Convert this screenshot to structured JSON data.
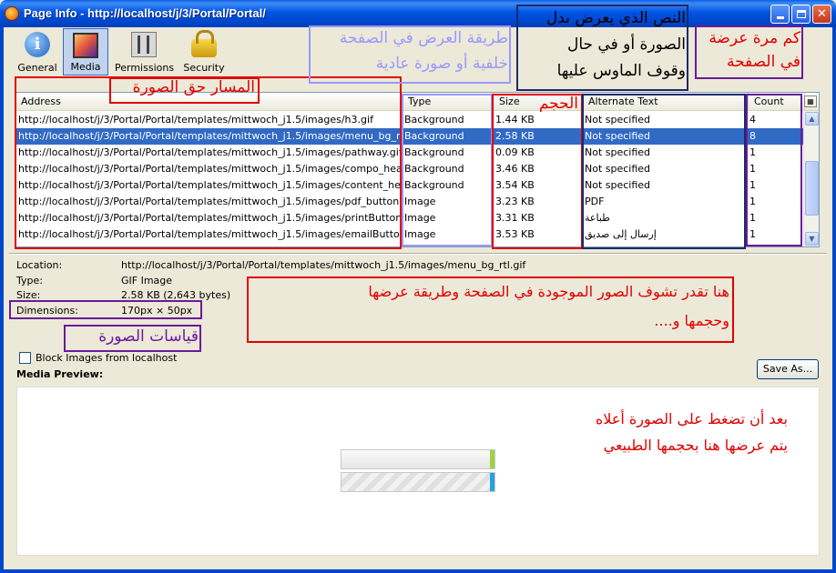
{
  "window": {
    "title": "Page Info - http://localhost/j/3/Portal/Portal/",
    "colors": {
      "titlebar": "#0054e3",
      "selection": "#316ac5",
      "annotation_red": "#e00000",
      "annotation_blue": "#9999ff",
      "annotation_purple": "#6a1b9a"
    }
  },
  "toolbar": {
    "general": "General",
    "media": "Media",
    "permissions": "Permissions",
    "security": "Security"
  },
  "table": {
    "headers": {
      "address": "Address",
      "type": "Type",
      "size": "Size",
      "alt": "Alternate Text",
      "count": "Count"
    },
    "rows": [
      {
        "address": "http://localhost/j/3/Portal/Portal/templates/mittwoch_j1.5/images/h3.gif",
        "type": "Background",
        "size": "1.44 KB",
        "alt": "Not specified",
        "count": "4"
      },
      {
        "address": "http://localhost/j/3/Portal/Portal/templates/mittwoch_j1.5/images/menu_bg_rtl.gif",
        "type": "Background",
        "size": "2.58 KB",
        "alt": "Not specified",
        "count": "8"
      },
      {
        "address": "http://localhost/j/3/Portal/Portal/templates/mittwoch_j1.5/images/pathway.gif",
        "type": "Background",
        "size": "0.09 KB",
        "alt": "Not specified",
        "count": "1"
      },
      {
        "address": "http://localhost/j/3/Portal/Portal/templates/mittwoch_j1.5/images/compo_head.png",
        "type": "Background",
        "size": "3.46 KB",
        "alt": "Not specified",
        "count": "1"
      },
      {
        "address": "http://localhost/j/3/Portal/Portal/templates/mittwoch_j1.5/images/content_head.png",
        "type": "Background",
        "size": "3.54 KB",
        "alt": "Not specified",
        "count": "1"
      },
      {
        "address": "http://localhost/j/3/Portal/Portal/templates/mittwoch_j1.5/images/pdf_button.png",
        "type": "Image",
        "size": "3.23 KB",
        "alt": "PDF",
        "count": "1"
      },
      {
        "address": "http://localhost/j/3/Portal/Portal/templates/mittwoch_j1.5/images/printButton.png",
        "type": "Image",
        "size": "3.31 KB",
        "alt": "طباعة",
        "count": "1"
      },
      {
        "address": "http://localhost/j/3/Portal/Portal/templates/mittwoch_j1.5/images/emailButton.png",
        "type": "Image",
        "size": "3.53 KB",
        "alt": "إرسال إلى صديق",
        "count": "1"
      }
    ]
  },
  "details": {
    "location_label": "Location:",
    "location_value": "http://localhost/j/3/Portal/Portal/templates/mittwoch_j1.5/images/menu_bg_rtl.gif",
    "type_label": "Type:",
    "type_value": "GIF Image",
    "size_label": "Size:",
    "size_value": "2.58 KB (2,643 bytes)",
    "dimensions_label": "Dimensions:",
    "dimensions_value": "170px × 50px",
    "block_label": "Block Images from localhost",
    "preview_title": "Media Preview:",
    "save_as": "Save As..."
  },
  "annotations": {
    "address_path": "المسار حق الصورة",
    "type_line1": "طريقة العرض في الصفحة",
    "type_line2": "خلفية أو صورة عادية",
    "size": "الحجم",
    "alt_line1": "النص الذي يعرض بدل",
    "alt_line2": "الصورة أو في حال",
    "alt_line3": "وقوف الماوس عليها",
    "count_line1": "كم مرة عرضة",
    "count_line2": "في الصفحة",
    "overview_line1": "هنا تقدر تشوف الصور الموجودة في الصفحة وطريقة عرضها",
    "overview_line2": "وحجمها و....",
    "dimensions": "قياسات الصورة",
    "preview_line1": "بعد أن تضغط على الصورة أعلاه",
    "preview_line2": "يتم عرضها هنا بحجمها الطبيعي"
  }
}
